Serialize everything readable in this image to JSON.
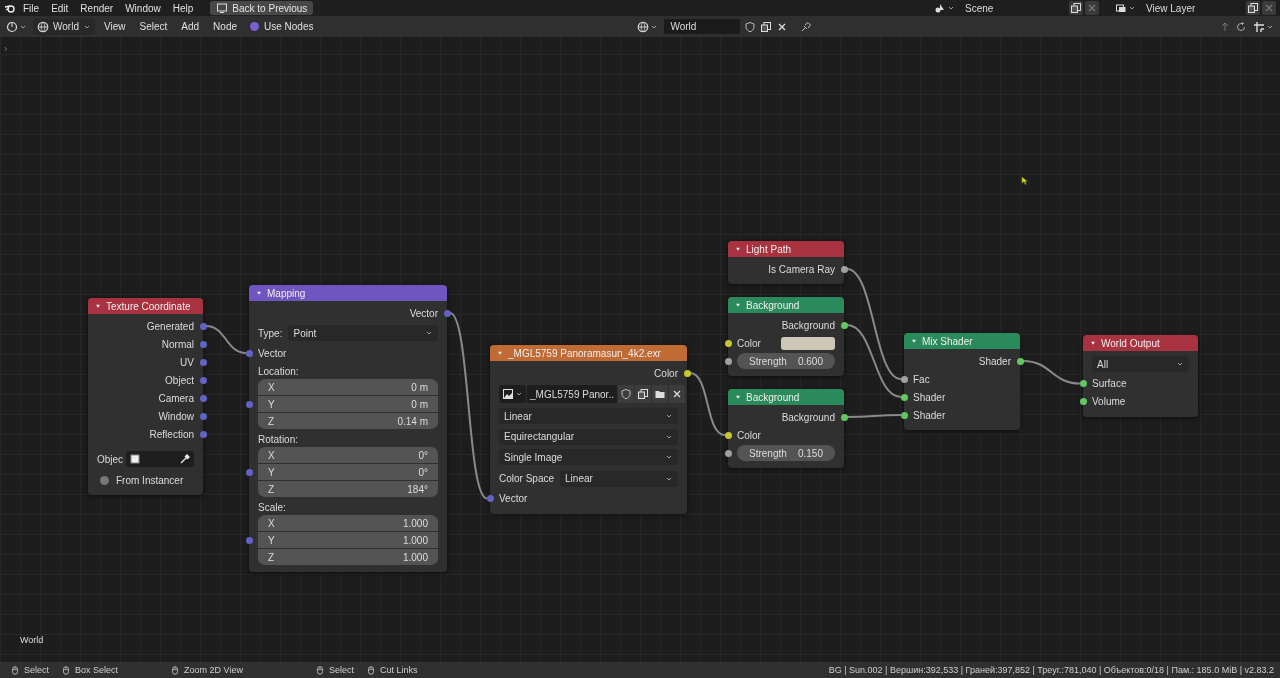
{
  "topbar": {
    "menus": [
      "File",
      "Edit",
      "Render",
      "Window",
      "Help"
    ],
    "back_button": "Back to Previous",
    "scene": "Scene",
    "view_layer": "View Layer"
  },
  "header": {
    "world_selector": "World",
    "menus": [
      "View",
      "Select",
      "Add",
      "Node"
    ],
    "use_nodes": {
      "label": "Use Nodes",
      "checked": true
    },
    "world_field": "World"
  },
  "canvas": {
    "label": "World",
    "nodes": [
      {
        "title": "Texture Coordinate",
        "color": "#a8323f",
        "rows": [
          {
            "kind": "output",
            "label": "Generated",
            "color": "#6363c7"
          },
          {
            "kind": "output",
            "label": "Normal",
            "color": "#6363c7"
          },
          {
            "kind": "output",
            "label": "UV",
            "color": "#6363c7"
          },
          {
            "kind": "output",
            "label": "Object",
            "color": "#6363c7"
          },
          {
            "kind": "output",
            "label": "Camera",
            "color": "#6363c7"
          },
          {
            "kind": "output",
            "label": "Window",
            "color": "#6363c7"
          },
          {
            "kind": "output",
            "label": "Reflection",
            "color": "#6363c7"
          },
          {
            "kind": "object",
            "label": "Objec"
          },
          {
            "kind": "toggle",
            "label": "From Instancer",
            "checked": false
          }
        ]
      },
      {
        "title": "Mapping",
        "color": "#6f55c0",
        "rows": [
          {
            "kind": "output",
            "label": "Vector",
            "color": "#6363c7"
          },
          {
            "kind": "select",
            "label": "Type:",
            "value": "Point"
          },
          {
            "kind": "input",
            "label": "Vector",
            "color": "#6363c7"
          },
          {
            "kind": "vector",
            "label": "Location:",
            "color": "#6363c7",
            "fields": [
              {
                "axis": "X",
                "value": "0 m"
              },
              {
                "axis": "Y",
                "value": "0 m"
              },
              {
                "axis": "Z",
                "value": "0.14 m"
              }
            ]
          },
          {
            "kind": "vector",
            "label": "Rotation:",
            "color": "#6363c7",
            "fields": [
              {
                "axis": "X",
                "value": "0°"
              },
              {
                "axis": "Y",
                "value": "0°"
              },
              {
                "axis": "Z",
                "value": "184°"
              }
            ]
          },
          {
            "kind": "vector",
            "label": "Scale:",
            "color": "#6363c7",
            "fields": [
              {
                "axis": "X",
                "value": "1.000"
              },
              {
                "axis": "Y",
                "value": "1.000"
              },
              {
                "axis": "Z",
                "value": "1.000"
              }
            ]
          }
        ]
      },
      {
        "title": "_MGL5759 Panoramasun_4k2.exr",
        "color": "#c06a34",
        "rows": [
          {
            "kind": "output",
            "label": "Color",
            "color": "#c7c729"
          },
          {
            "kind": "image",
            "value": "_MGL5759 Panor.."
          },
          {
            "kind": "dropdown",
            "value": "Linear"
          },
          {
            "kind": "dropdown",
            "value": "Equirectangular"
          },
          {
            "kind": "dropdown",
            "value": "Single Image"
          },
          {
            "kind": "select",
            "label": "Color Space",
            "value": "Linear"
          },
          {
            "kind": "input",
            "label": "Vector",
            "color": "#6363c7"
          }
        ]
      },
      {
        "title": "Light Path",
        "color": "#a8323f",
        "rows": [
          {
            "kind": "output",
            "label": "Is Camera Ray",
            "color": "#a1a1a1"
          }
        ]
      },
      {
        "title": "Background",
        "color": "#2b8a5b",
        "rows": [
          {
            "kind": "output",
            "label": "Background",
            "color": "#63c763"
          },
          {
            "kind": "color",
            "label": "Color",
            "color": "#c7c729",
            "swatch": {
              "color": "#cfc8b9"
            }
          },
          {
            "kind": "value",
            "label": "Strength",
            "value": "0.600",
            "color": "#a1a1a1"
          }
        ]
      },
      {
        "title": "Background",
        "color": "#2b8a5b",
        "rows": [
          {
            "kind": "output",
            "label": "Background",
            "color": "#63c763"
          },
          {
            "kind": "input",
            "label": "Color",
            "color": "#c7c729"
          },
          {
            "kind": "value",
            "label": "Strength",
            "value": "0.150",
            "color": "#a1a1a1"
          }
        ]
      },
      {
        "title": "Mix Shader",
        "color": "#2b8a5b",
        "rows": [
          {
            "kind": "output",
            "label": "Shader",
            "color": "#63c763"
          },
          {
            "kind": "input",
            "label": "Fac",
            "color": "#a1a1a1"
          },
          {
            "kind": "input",
            "label": "Shader",
            "color": "#63c763"
          },
          {
            "kind": "input",
            "label": "Shader",
            "color": "#63c763"
          }
        ]
      },
      {
        "title": "World Output",
        "color": "#a8323f",
        "rows": [
          {
            "kind": "dropdown",
            "value": "All"
          },
          {
            "kind": "input",
            "label": "Surface",
            "color": "#63c763"
          },
          {
            "kind": "input",
            "label": "Volume",
            "color": "#63c763"
          }
        ]
      }
    ]
  },
  "status_bar": {
    "hints": [
      "Select",
      "Box Select",
      "Zoom 2D View",
      "Select",
      "Cut Links"
    ],
    "stats": "BG | Sun.002 | Вершин:392,533 | Граней:397,852 | Треуг.:781,040 | Объектов:0/18 | Пам.: 185.0 MiB | v2.83.2"
  }
}
